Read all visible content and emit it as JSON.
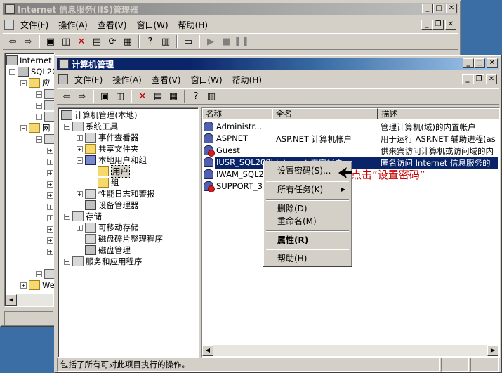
{
  "iis_window": {
    "title": "Internet 信息服务(IIS)管理器",
    "menu": [
      "文件(F)",
      "操作(A)",
      "查看(V)",
      "窗口(W)",
      "帮助(H)"
    ],
    "tree": [
      "Internet",
      "SQL20",
      "应",
      "网",
      "We"
    ]
  },
  "cm_window": {
    "title": "计算机管理",
    "menu": [
      "文件(F)",
      "操作(A)",
      "查看(V)",
      "窗口(W)",
      "帮助(H)"
    ],
    "tree": {
      "root": "计算机管理(本地)",
      "system_tools": "系统工具",
      "event_viewer": "事件查看器",
      "shared_folders": "共享文件夹",
      "local_users_groups": "本地用户和组",
      "users": "用户",
      "groups": "组",
      "perf_logs": "性能日志和警报",
      "device_manager": "设备管理器",
      "storage": "存储",
      "removable_storage": "可移动存储",
      "defrag": "磁盘碎片整理程序",
      "disk_management": "磁盘管理",
      "services_apps": "服务和应用程序"
    },
    "list": {
      "columns": [
        "名称",
        "全名",
        "描述"
      ],
      "rows": [
        {
          "name": "Administr...",
          "fullname": "",
          "description": "管理计算机(域)的内置帐户",
          "disabled": false
        },
        {
          "name": "ASPNET",
          "fullname": "ASP.NET 计算机帐户",
          "description": "用于运行 ASP.NET 辅助进程(as",
          "disabled": false
        },
        {
          "name": "Guest",
          "fullname": "",
          "description": "供来宾访问计算机或访问域的内",
          "disabled": true
        },
        {
          "name": "IUSR_SQL2005",
          "fullname": "Internet 来宾帐户",
          "description": "匿名访问 Internet 信息服务的",
          "disabled": false
        },
        {
          "name": "IWAM_SQL2005",
          "fullname": "",
          "description": "",
          "disabled": false
        },
        {
          "name": "SUPPORT_3...",
          "fullname": "",
          "description": "",
          "disabled": true
        }
      ]
    },
    "status": "包括了所有可对此项目执行的操作。"
  },
  "context_menu": {
    "set_password": "设置密码(S)...",
    "all_tasks": "所有任务(K)",
    "delete": "删除(D)",
    "rename": "重命名(M)",
    "properties": "属性(R)",
    "help": "帮助(H)"
  },
  "annotation": "点击”设置密码”",
  "colors": {
    "selection": "#0a246a",
    "annotation": "#cc0000",
    "desktop": "#3a6ea5"
  }
}
